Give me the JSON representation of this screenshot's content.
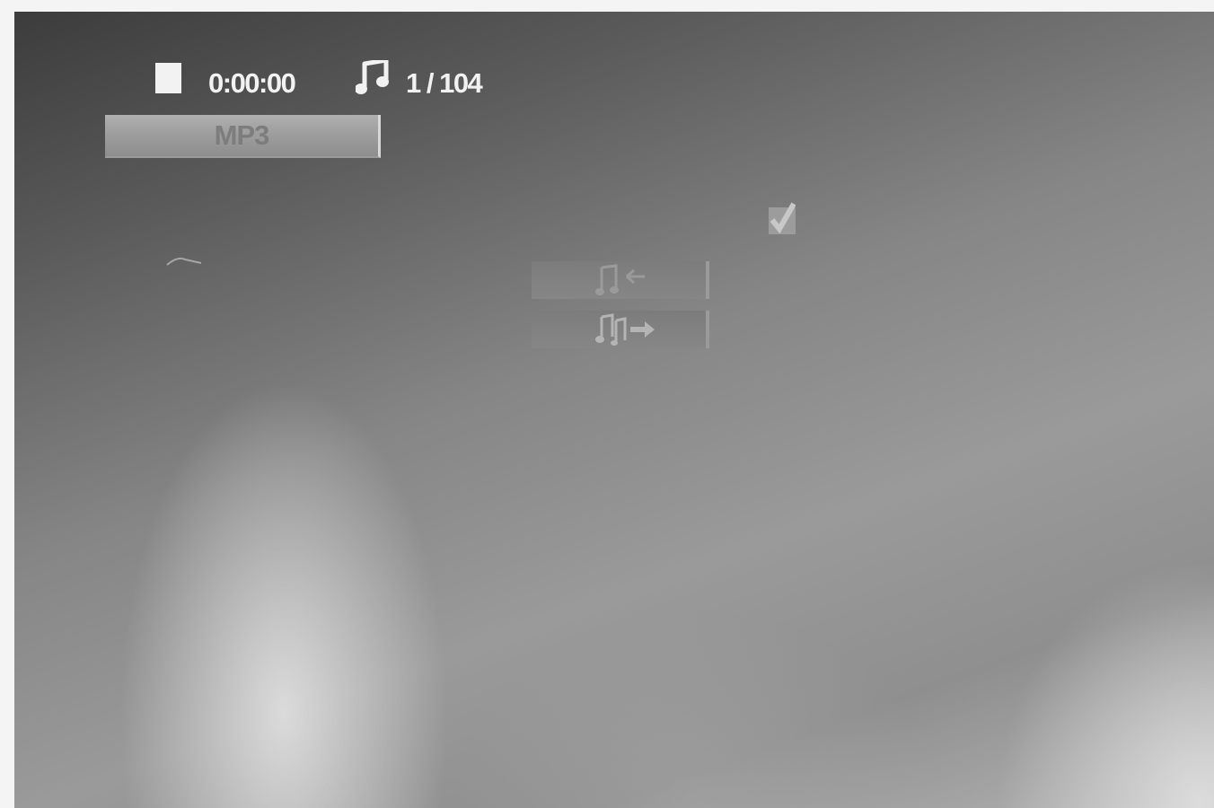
{
  "status_bar": {
    "playback_state_icon": "stop-icon",
    "elapsed_time": "0:00:00",
    "track_icon": "music-note-icon",
    "track_counter": "1 / 104"
  },
  "file_type": {
    "label": "MP3"
  },
  "selection_check_icon": "checkmark-icon",
  "buttons": [
    {
      "id": "add-to-program",
      "icon": "music-note-arrow-icon"
    },
    {
      "id": "program-move",
      "icon": "notes-arrow-right-icon"
    }
  ],
  "colors": {
    "text": "#f2f2f2",
    "bar": "#a0a0a0"
  }
}
